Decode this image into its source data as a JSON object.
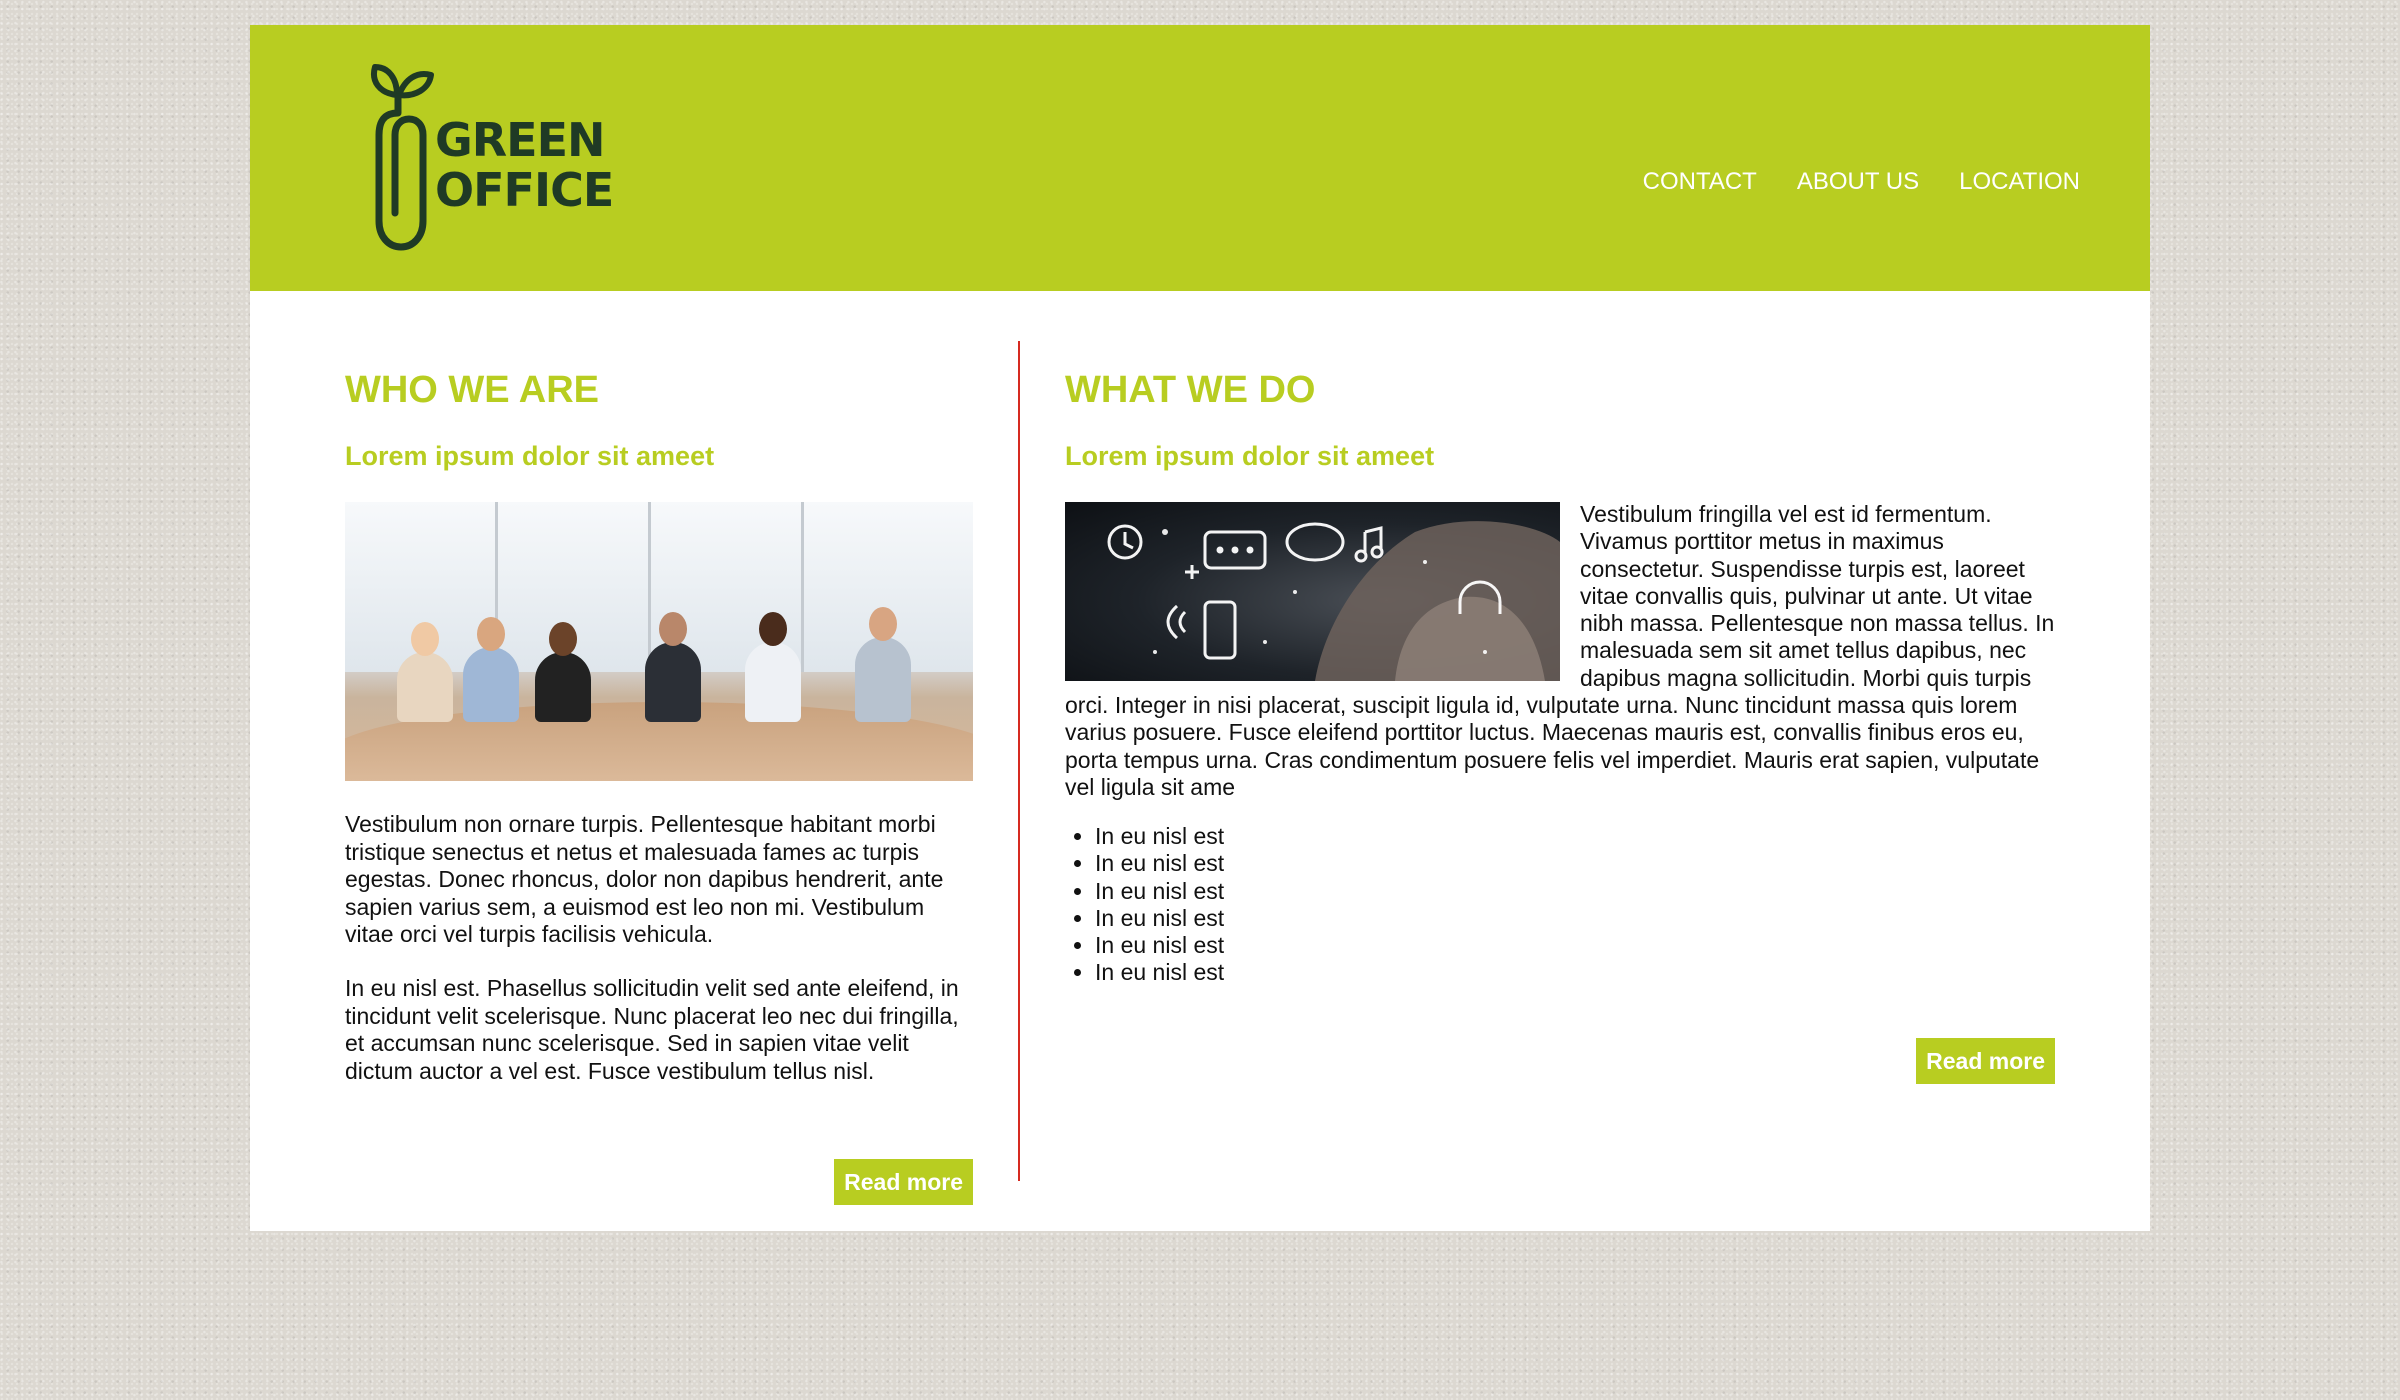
{
  "brand": {
    "line1": "GREEN",
    "line2": "OFFICE",
    "logo_icon": "paperclip-sprout-icon",
    "accent_color": "#b8cd21",
    "divider_color": "#d62a20"
  },
  "nav": {
    "items": [
      "CONTACT",
      "ABOUT US",
      "LOCATION"
    ]
  },
  "who": {
    "title": "WHO WE ARE",
    "subtitle": "Lorem ipsum dolor sit ameet",
    "paragraphs": [
      "Vestibulum non ornare turpis. Pellentesque habitant morbi tristique senectus et netus et malesuada fames ac turpis egestas. Donec rhoncus, dolor non dapibus hendrerit, ante sapien varius sem, a euismod est leo non mi. Vestibulum vitae orci vel turpis facilisis vehicula.",
      "In eu nisl est. Phasellus sollicitudin velit sed ante eleifend, in tincidunt velit scelerisque. Nunc placerat leo nec dui fringilla, et accumsan nunc scelerisque. Sed in sapien vitae velit dictum auctor a vel est. Fusce vestibulum tellus nisl."
    ],
    "button": "Read more"
  },
  "what": {
    "title": "WHAT WE DO",
    "subtitle": "Lorem ipsum dolor sit ameet",
    "paragraph": "Vestibulum fringilla vel est id fermentum. Vivamus porttitor metus in maximus consectetur. Suspendisse turpis est, laoreet vitae convallis quis, pulvinar ut ante. Ut vitae nibh massa. Pellentesque non massa tellus. In malesuada sem sit amet tellus dapibus, nec dapibus magna sollicitudin. Morbi quis turpis orci. Integer in nisi placerat, suscipit ligula id, vulputate urna. Nunc tincidunt massa quis lorem varius posuere. Fusce eleifend porttitor luctus. Maecenas mauris est, convallis finibus eros eu, porta tempus urna. Cras condimentum posuere felis vel imperdiet. Mauris erat sapien, vulputate vel ligula sit ame",
    "list": [
      "In eu nisl est",
      "In eu nisl est",
      "In eu nisl est",
      "In eu nisl est",
      "In eu nisl est",
      "In eu nisl est"
    ],
    "button": "Read more"
  }
}
